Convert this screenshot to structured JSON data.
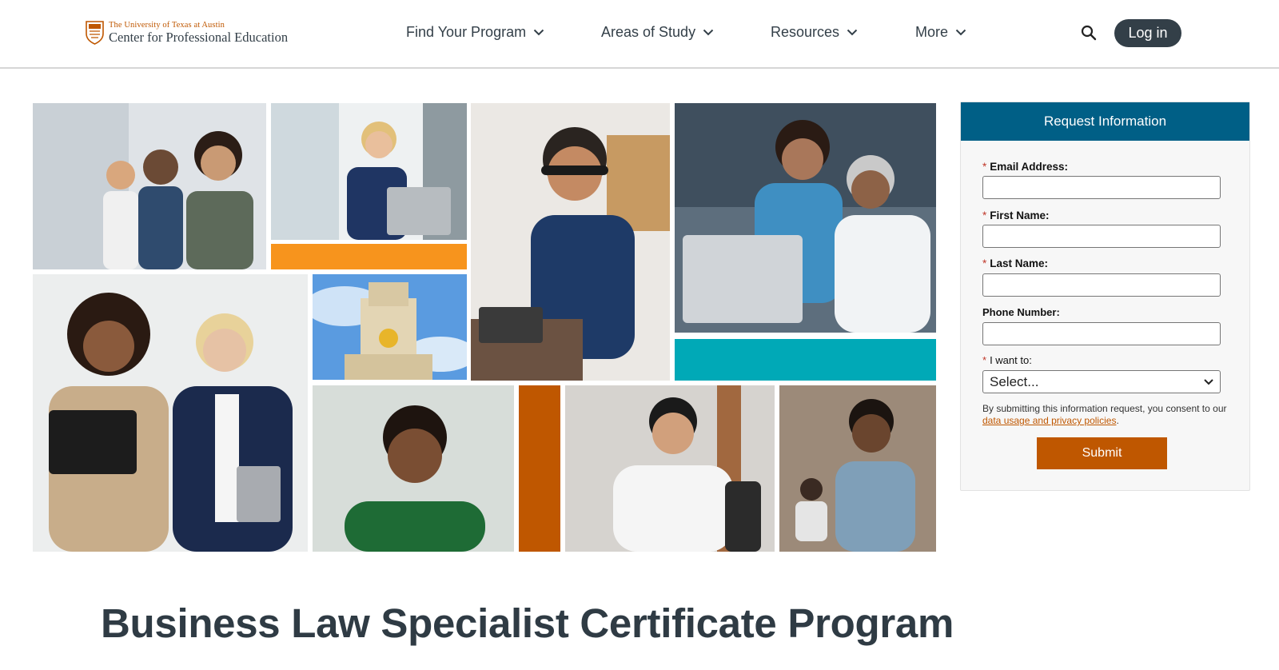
{
  "header": {
    "logo": {
      "line1": "The University of Texas at Austin",
      "line2": "Center for Professional Education",
      "icon": "ut-shield-icon"
    },
    "nav": [
      {
        "label": "Find Your Program"
      },
      {
        "label": "Areas of Study"
      },
      {
        "label": "Resources"
      },
      {
        "label": "More"
      }
    ],
    "search_icon": "search-icon",
    "login_label": "Log in"
  },
  "colors": {
    "burnt_orange": "#bf5700",
    "charcoal": "#333f48",
    "teal_header": "#005f86",
    "orange_block": "#f7941d",
    "teal_block": "#00a9b7"
  },
  "form": {
    "title": "Request Information",
    "fields": [
      {
        "label": "Email Address:",
        "required": true,
        "value": ""
      },
      {
        "label": "First Name:",
        "required": true,
        "value": ""
      },
      {
        "label": "Last Name:",
        "required": true,
        "value": ""
      },
      {
        "label": "Phone Number:",
        "required": false,
        "value": ""
      }
    ],
    "select_label": "I want to:",
    "select_value": "Select...",
    "consent_text": "By submitting this information request, you consent to our ",
    "consent_link": "data usage and privacy policies",
    "consent_end": ".",
    "submit_label": "Submit"
  },
  "page_title": "Business Law Specialist Certificate Program"
}
